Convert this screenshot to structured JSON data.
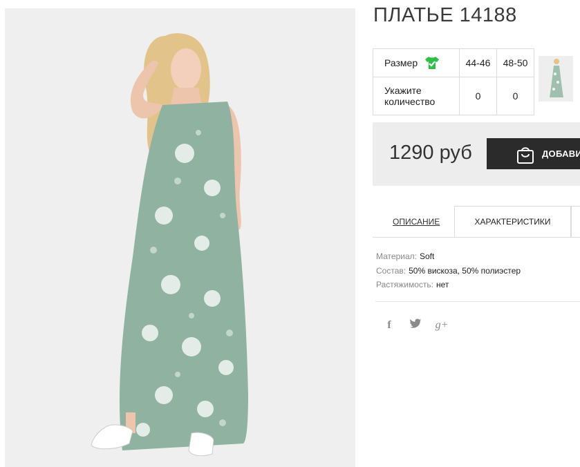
{
  "product": {
    "title": "ПЛАТЬЕ 14188",
    "photo": {
      "subject": "model in long sleeveless sage-green dress with white poppy print and white sneakers"
    }
  },
  "size_table": {
    "size_label": "Размер",
    "size_icon": "tshirt-check-icon",
    "quantity_label": "Укажите количество",
    "sizes": [
      {
        "size": "44-46",
        "quantity": "0"
      },
      {
        "size": "48-50",
        "quantity": "0"
      }
    ]
  },
  "thumbnail": {
    "icon": "dress-thumbnail"
  },
  "purchase": {
    "price": "1290 руб",
    "add_button_label": "ДОБАВИТЬ",
    "button_icon": "shopping-bag-icon"
  },
  "tabs": {
    "description_label": "ОПИСАНИЕ",
    "characteristics_label": "ХАРАКТЕРИСТИКИ",
    "active": "characteristics"
  },
  "characteristics": [
    {
      "key": "Материал:",
      "value": "Soft"
    },
    {
      "key": "Состав:",
      "value": "50% вискоза, 50% полиэстер"
    },
    {
      "key": "Растяжимость:",
      "value": "нет"
    }
  ],
  "social": {
    "facebook": "f",
    "twitter": "twitter-bird-icon",
    "google_plus": "g+"
  },
  "colors": {
    "accent_green": "#2fbf47",
    "button_dark": "#2b2b2b",
    "price_panel": "#ededed",
    "dress_sage": "#8fb3a0"
  }
}
